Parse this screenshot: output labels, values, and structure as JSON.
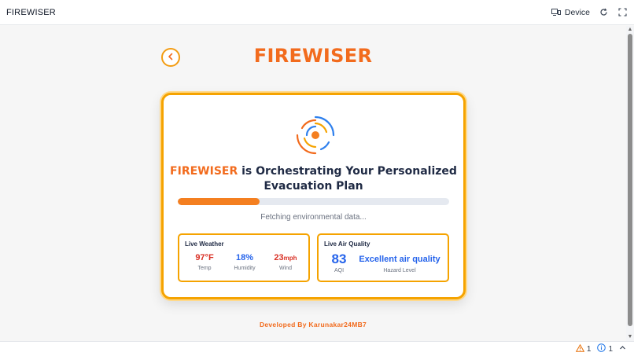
{
  "topbar": {
    "title": "FIREWISER",
    "device_label": "Device",
    "device_icon": "device-icon",
    "refresh_icon": "refresh-icon",
    "expand_icon": "expand-icon"
  },
  "page": {
    "brand": "FIREWISER",
    "back_icon": "chevron-left-icon",
    "headline_brand": "FIREWISER",
    "headline_rest": " is Orchestrating Your Personalized Evacuation Plan",
    "progress_percent": 30,
    "status_text": "Fetching environmental data...",
    "weather": {
      "title": "Live Weather",
      "temp_value": "97°F",
      "temp_label": "Temp",
      "humidity_value": "18%",
      "humidity_label": "Humidity",
      "wind_number": "23",
      "wind_unit": "mph",
      "wind_label": "Wind"
    },
    "air": {
      "title": "Live Air Quality",
      "aqi_value": "83",
      "aqi_label": "AQI",
      "hazard_value": "Excellent air quality",
      "hazard_label": "Hazard Level"
    },
    "credit": "Developed By Karunakar24MB7"
  },
  "statusbar": {
    "warnings_count": "1",
    "info_count": "1"
  },
  "colors": {
    "brand_orange": "#f26b1d",
    "card_border": "#f5a300",
    "accent_blue": "#2563eb",
    "alert_red": "#d93025"
  }
}
